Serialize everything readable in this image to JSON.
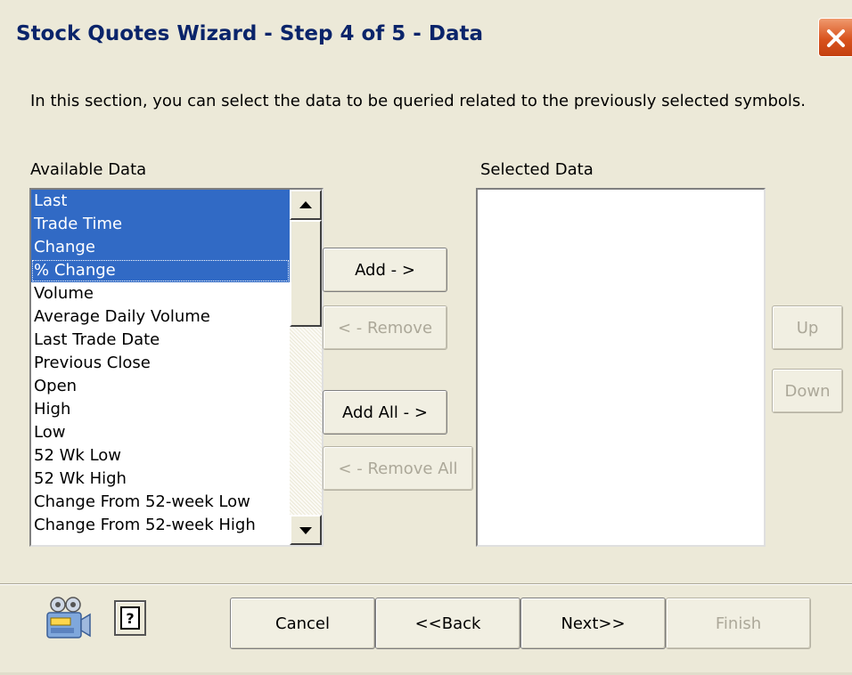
{
  "window": {
    "title": "Stock Quotes Wizard - Step 4 of 5 - Data"
  },
  "intro_text": "In this section, you can select the data to be queried related to the previously selected symbols.",
  "available": {
    "label": "Available Data",
    "items": [
      {
        "label": "Last",
        "selected": true
      },
      {
        "label": "Trade Time",
        "selected": true
      },
      {
        "label": "Change",
        "selected": true
      },
      {
        "label": "% Change",
        "selected": true,
        "focused": true
      },
      {
        "label": "Volume",
        "selected": false
      },
      {
        "label": "Average Daily Volume",
        "selected": false
      },
      {
        "label": "Last Trade Date",
        "selected": false
      },
      {
        "label": "Previous Close",
        "selected": false
      },
      {
        "label": "Open",
        "selected": false
      },
      {
        "label": "High",
        "selected": false
      },
      {
        "label": "Low",
        "selected": false
      },
      {
        "label": "52 Wk Low",
        "selected": false
      },
      {
        "label": "52 Wk High",
        "selected": false
      },
      {
        "label": "Change From 52-week Low",
        "selected": false
      },
      {
        "label": "Change From 52-week High",
        "selected": false
      }
    ]
  },
  "selected_data": {
    "label": "Selected Data",
    "items": []
  },
  "transfer_buttons": {
    "add": "Add - >",
    "remove": "< - Remove",
    "add_all": "Add All - >",
    "remove_all": "< - Remove All"
  },
  "order_buttons": {
    "up": "Up",
    "down": "Down"
  },
  "footer": {
    "cancel": "Cancel",
    "back": "<<Back",
    "next": "Next>>",
    "finish": "Finish"
  },
  "icons": {
    "close": "close-icon",
    "camera": "video-camera-icon",
    "help": "help-icon",
    "scroll_up": "scroll-up-arrow-icon",
    "scroll_down": "scroll-down-arrow-icon"
  },
  "colors": {
    "dialog_bg": "#ece9d8",
    "title_text": "#0a246a",
    "selection": "#316ac5",
    "close_button": "#d9531e",
    "disabled_text": "#aca899"
  }
}
